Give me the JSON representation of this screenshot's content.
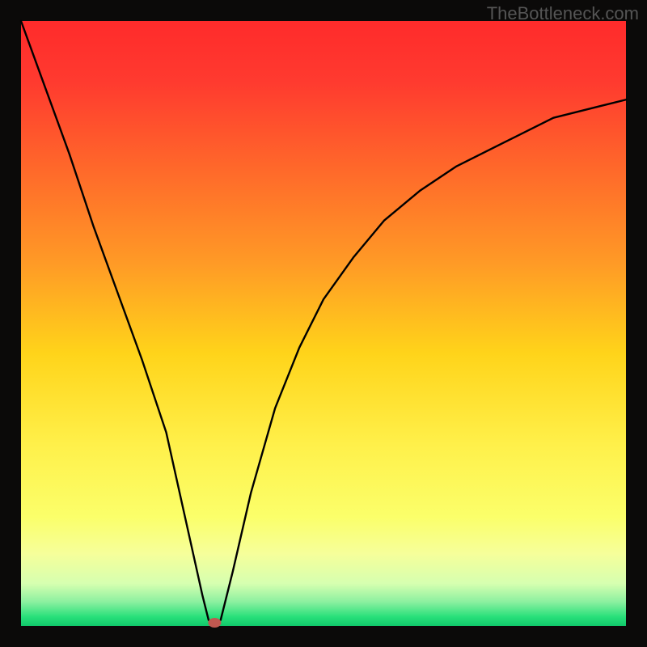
{
  "watermark": "TheBottleneck.com",
  "chart_data": {
    "type": "line",
    "title": "",
    "xlabel": "",
    "ylabel": "",
    "xlim": [
      0,
      100
    ],
    "ylim": [
      0,
      100
    ],
    "background_gradient_stops": [
      {
        "offset": 0.0,
        "color": "#ff2b2b"
      },
      {
        "offset": 0.1,
        "color": "#ff3a2f"
      },
      {
        "offset": 0.25,
        "color": "#ff6a2a"
      },
      {
        "offset": 0.4,
        "color": "#ff9a26"
      },
      {
        "offset": 0.55,
        "color": "#ffd41a"
      },
      {
        "offset": 0.7,
        "color": "#fff04a"
      },
      {
        "offset": 0.82,
        "color": "#fbff6a"
      },
      {
        "offset": 0.88,
        "color": "#f6ff9a"
      },
      {
        "offset": 0.93,
        "color": "#d6ffb0"
      },
      {
        "offset": 0.96,
        "color": "#8cf0a0"
      },
      {
        "offset": 0.985,
        "color": "#28e07a"
      },
      {
        "offset": 1.0,
        "color": "#10c86a"
      }
    ],
    "series": [
      {
        "name": "bottleneck-curve",
        "x": [
          0,
          4,
          8,
          12,
          16,
          20,
          24,
          28,
          30,
          31,
          32,
          33,
          35,
          38,
          42,
          46,
          50,
          55,
          60,
          66,
          72,
          80,
          88,
          96,
          100
        ],
        "values": [
          100,
          89,
          78,
          66,
          55,
          44,
          32,
          14,
          5,
          1,
          0,
          1,
          9,
          22,
          36,
          46,
          54,
          61,
          67,
          72,
          76,
          80,
          84,
          86,
          87
        ]
      }
    ],
    "marker": {
      "x": 32,
      "y": 0,
      "color": "#c05850"
    },
    "frame": {
      "color": "#0b0a09",
      "width": 26
    }
  }
}
